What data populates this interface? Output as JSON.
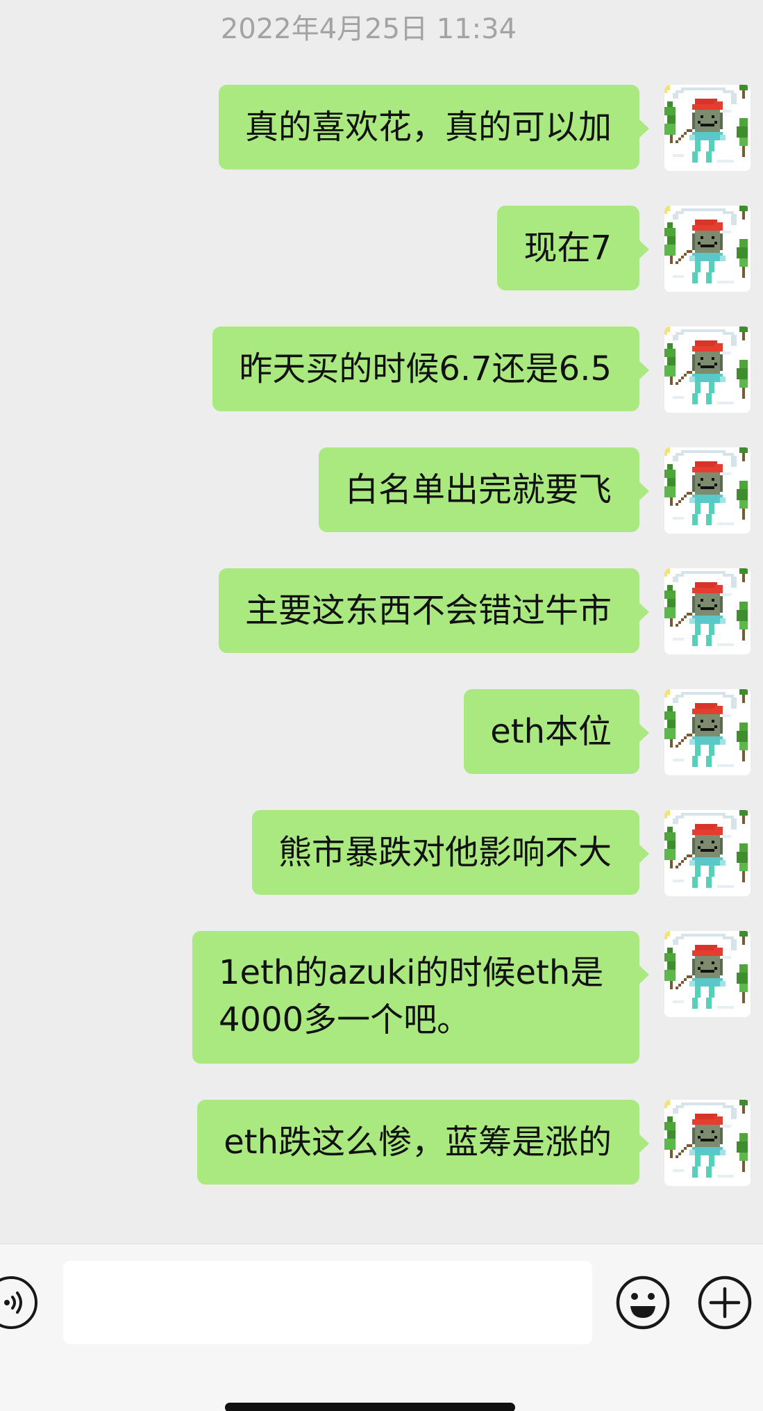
{
  "timestamp": "2022年4月25日 11:34",
  "messages": [
    {
      "text": "真的喜欢花，真的可以加"
    },
    {
      "text": "现在7"
    },
    {
      "text": "昨天买的时候6.7还是6.5"
    },
    {
      "text": "白名单出完就要飞"
    },
    {
      "text": "主要这东西不会错过牛市"
    },
    {
      "text": "eth本位"
    },
    {
      "text": "熊市暴跌对他影响不大"
    },
    {
      "text": "1eth的azuki的时候eth是4000多一个吧。"
    },
    {
      "text": "eth跌这么惨，蓝筹是涨的"
    }
  ],
  "input": {
    "value": "",
    "placeholder": ""
  },
  "icons": {
    "voice": "voice-icon",
    "emoji": "emoji-icon",
    "plus": "plus-icon",
    "avatar": "pixel-art-avatar-icon"
  },
  "colors": {
    "background": "#ededed",
    "bubble": "#a9e97f",
    "input_bar": "#f6f6f6",
    "timestamp": "#a3a3a3"
  }
}
